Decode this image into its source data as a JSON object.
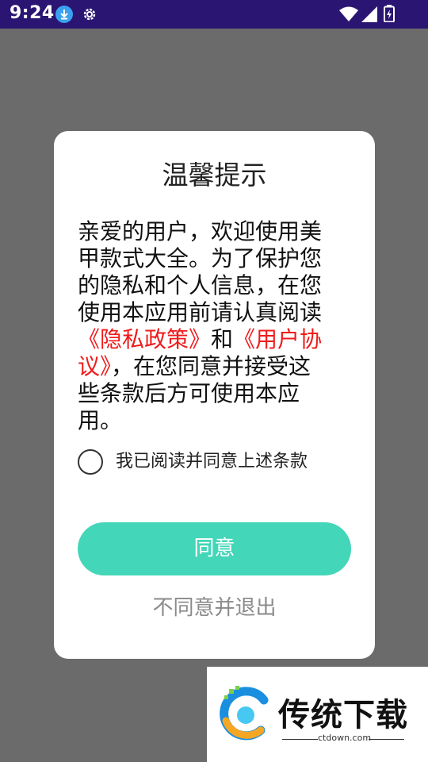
{
  "status_bar": {
    "time": "9:24",
    "icons": [
      "download-icon",
      "gear-icon",
      "wifi-icon",
      "signal-icon",
      "battery-icon"
    ]
  },
  "dialog": {
    "title": "温馨提示",
    "message_parts": {
      "p1": "亲爱的用户，欢迎使用美甲款式大全。为了保护您的隐私和个人信息，在您使用本应用前请认真阅读",
      "privacy_link": "《隐私政策》",
      "p2": "和",
      "agreement_link": "《用户协议》",
      "p3": "，在您同意并接受这些条款后方可使用本应用。"
    },
    "checkbox_label": "我已阅读并同意上述条款",
    "checkbox_checked": false,
    "agree_button": "同意",
    "disagree_link": "不同意并退出"
  },
  "watermark": {
    "title": "传统下载",
    "url": "ctdown.com"
  },
  "colors": {
    "status_bar": "#2a1572",
    "overlay": "#6b6b6b",
    "accent_button": "#43d6b8",
    "link_red": "#ef1b1b"
  }
}
